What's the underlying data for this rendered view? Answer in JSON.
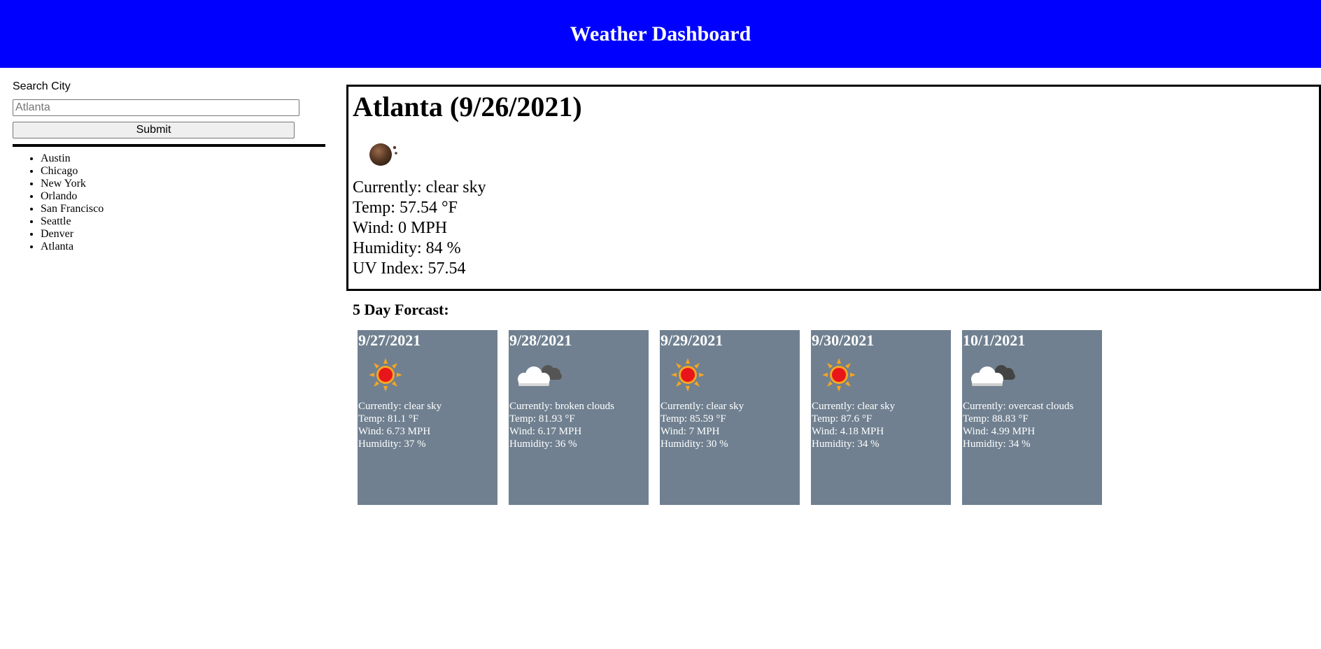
{
  "header": {
    "title": "Weather Dashboard",
    "bg_color": "#0000ff"
  },
  "sidebar": {
    "search_label": "Search City",
    "search_placeholder": "Atlanta",
    "search_value": "",
    "submit_label": "Submit",
    "cities": [
      "Austin",
      "Chicago",
      "New York",
      "Orlando",
      "San Francisco",
      "Seattle",
      "Denver",
      "Atlanta"
    ]
  },
  "current": {
    "title": "Atlanta (9/26/2021)",
    "icon": "night-clear-icon",
    "description": "Currently: clear sky",
    "temp": "Temp: 57.54 °F",
    "wind": "Wind: 0 MPH",
    "humidity": "Humidity: 84 %",
    "uv": "UV Index: 57.54"
  },
  "forecast": {
    "title": "5 Day Forcast:",
    "card_color": "#708090",
    "days": [
      {
        "date": "9/27/2021",
        "icon": "sun-icon",
        "description": "Currently: clear sky",
        "temp": "Temp: 81.1 °F",
        "wind": "Wind: 6.73 MPH",
        "humidity": "Humidity: 37 %"
      },
      {
        "date": "9/28/2021",
        "icon": "broken-clouds-icon",
        "description": "Currently: broken clouds",
        "temp": "Temp: 81.93 °F",
        "wind": "Wind: 6.17 MPH",
        "humidity": "Humidity: 36 %"
      },
      {
        "date": "9/29/2021",
        "icon": "sun-icon",
        "description": "Currently: clear sky",
        "temp": "Temp: 85.59 °F",
        "wind": "Wind: 7 MPH",
        "humidity": "Humidity: 30 %"
      },
      {
        "date": "9/30/2021",
        "icon": "sun-icon",
        "description": "Currently: clear sky",
        "temp": "Temp: 87.6 °F",
        "wind": "Wind: 4.18 MPH",
        "humidity": "Humidity: 34 %"
      },
      {
        "date": "10/1/2021",
        "icon": "overcast-clouds-icon",
        "description": "Currently: overcast clouds",
        "temp": "Temp: 88.83 °F",
        "wind": "Wind: 4.99 MPH",
        "humidity": "Humidity: 34 %"
      }
    ]
  }
}
